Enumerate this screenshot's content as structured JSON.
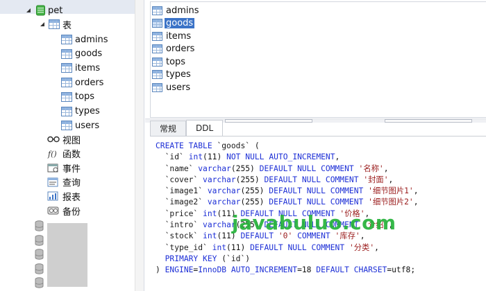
{
  "tree": {
    "database": "pet",
    "tables_node": "表",
    "tables": [
      "admins",
      "goods",
      "items",
      "orders",
      "tops",
      "types",
      "users"
    ],
    "other_nodes": [
      "视图",
      "函数",
      "事件",
      "查询",
      "报表",
      "备份"
    ]
  },
  "list": {
    "items": [
      "admins",
      "goods",
      "items",
      "orders",
      "tops",
      "types",
      "users"
    ],
    "selected": "goods"
  },
  "tabs": [
    "常规",
    "DDL"
  ],
  "active_tab": "DDL",
  "ddl_lines": [
    "CREATE TABLE `goods` (",
    "  `id` int(11) NOT NULL AUTO_INCREMENT,",
    "  `name` varchar(255) DEFAULT NULL COMMENT '名称',",
    "  `cover` varchar(255) DEFAULT NULL COMMENT '封面',",
    "  `image1` varchar(255) DEFAULT NULL COMMENT '细节图片1',",
    "  `image2` varchar(255) DEFAULT NULL COMMENT '细节图片2',",
    "  `price` int(11) DEFAULT NULL COMMENT '价格',",
    "  `intro` varchar(255) DEFAULT NULL COMMENT '介绍',",
    "  `stock` int(11) DEFAULT '0' COMMENT '库存',",
    "  `type_id` int(11) DEFAULT NULL COMMENT '分类',",
    "  PRIMARY KEY (`id`)",
    ") ENGINE=InnoDB AUTO_INCREMENT=18 DEFAULT CHARSET=utf8;"
  ],
  "watermark": "javabuluo.com",
  "colors": {
    "selection": "#3b73c7",
    "keyword": "#1d2fd6",
    "string": "#9a1b1b",
    "watermark": "#25b33a"
  }
}
